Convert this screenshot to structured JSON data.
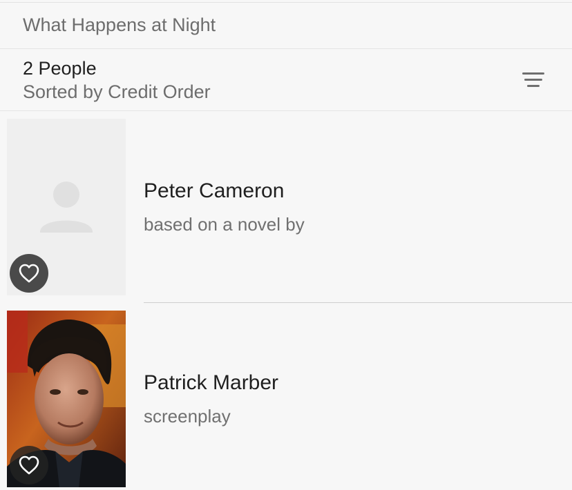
{
  "header": {
    "title": "What Happens at Night",
    "count_label": "2 People",
    "sort_label": "Sorted by Credit Order",
    "sort_icon": "sort-lines-icon"
  },
  "people": [
    {
      "name": "Peter Cameron",
      "role": "based on a novel by",
      "photo": "placeholder-person-icon",
      "favorite_icon": "heart-outline-icon"
    },
    {
      "name": "Patrick Marber",
      "role": "screenplay",
      "photo": "headshot-photo",
      "favorite_icon": "heart-outline-icon"
    }
  ],
  "colors": {
    "background": "#f7f7f7",
    "primary_text": "#1f1f1f",
    "secondary_text": "#6d6d6d",
    "divider": "#e4e4e4"
  }
}
